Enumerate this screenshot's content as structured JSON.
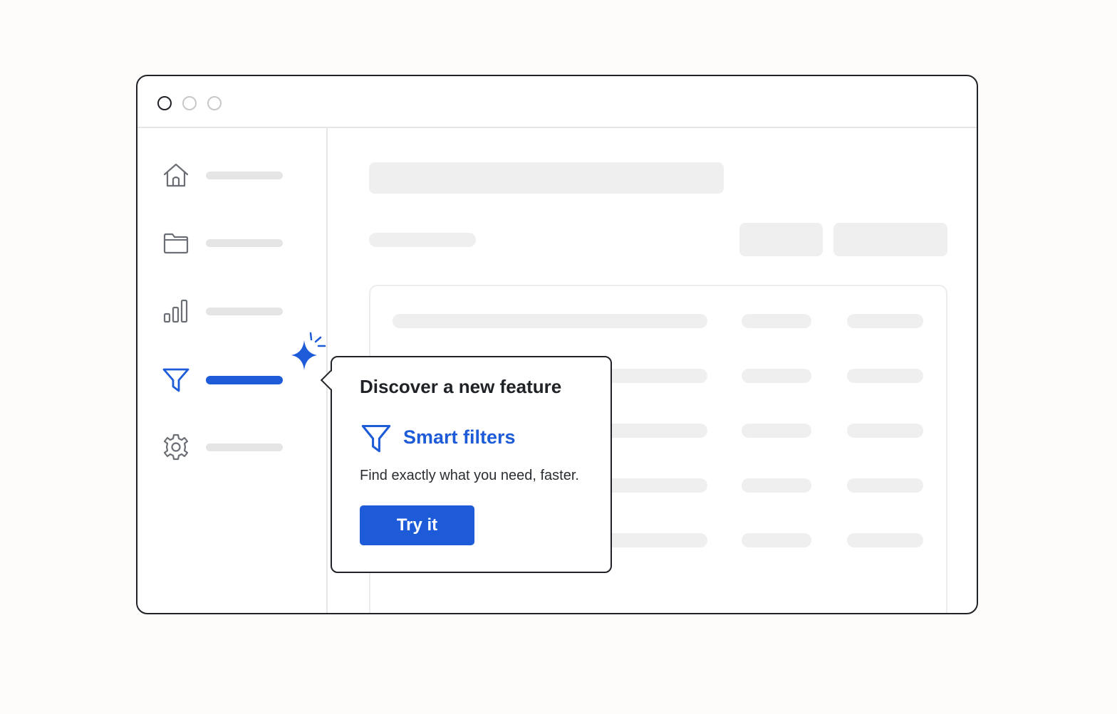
{
  "window": {
    "controls": [
      "close",
      "minimize",
      "maximize"
    ]
  },
  "sidebar": {
    "items": [
      {
        "icon": "home-icon",
        "active": false
      },
      {
        "icon": "folder-icon",
        "active": false
      },
      {
        "icon": "bar-chart-icon",
        "active": false
      },
      {
        "icon": "filter-icon",
        "active": true
      },
      {
        "icon": "gear-icon",
        "active": false
      }
    ]
  },
  "popover": {
    "title": "Discover a new feature",
    "feature_icon": "filter-icon",
    "feature_name": "Smart filters",
    "description": "Find exactly what you need, faster.",
    "button_label": "Try it"
  },
  "colors": {
    "accent": "#1d5bd8",
    "outline": "#1f2226",
    "placeholder": "#efefef",
    "background": "#fdfcfa"
  }
}
